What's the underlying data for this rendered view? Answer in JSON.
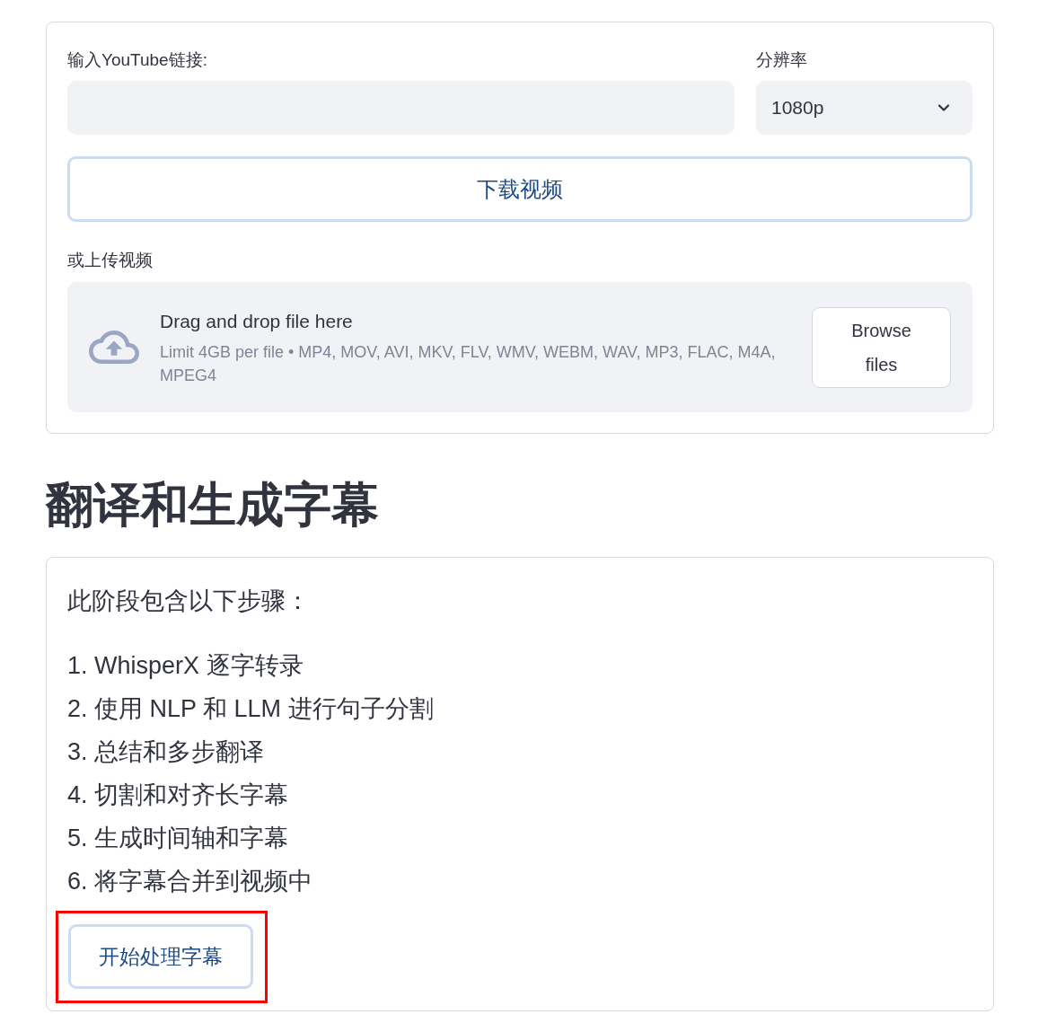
{
  "download_section": {
    "url_field": {
      "label": "输入YouTube链接:"
    },
    "resolution": {
      "label": "分辨率",
      "value": "1080p"
    },
    "download_button": "下载视频",
    "upload": {
      "label": "或上传视频",
      "dropzone_title": "Drag and drop file here",
      "dropzone_hint": "Limit 4GB per file • MP4, MOV, AVI, MKV, FLV, WMV, WEBM, WAV, MP3, FLAC, M4A, MPEG4",
      "browse_button": "Browse files"
    }
  },
  "subtitle_section": {
    "heading": "翻译和生成字幕",
    "intro": "此阶段包含以下步骤：",
    "steps": [
      "1. WhisperX 逐字转录",
      "2. 使用 NLP 和 LLM 进行句子分割",
      "3. 总结和多步翻译",
      "4. 切割和对齐长字幕",
      "5. 生成时间轴和字幕",
      "6. 将字幕合并到视频中"
    ],
    "start_button": {
      "label": "开始处理字幕",
      "highlighted": true
    }
  }
}
